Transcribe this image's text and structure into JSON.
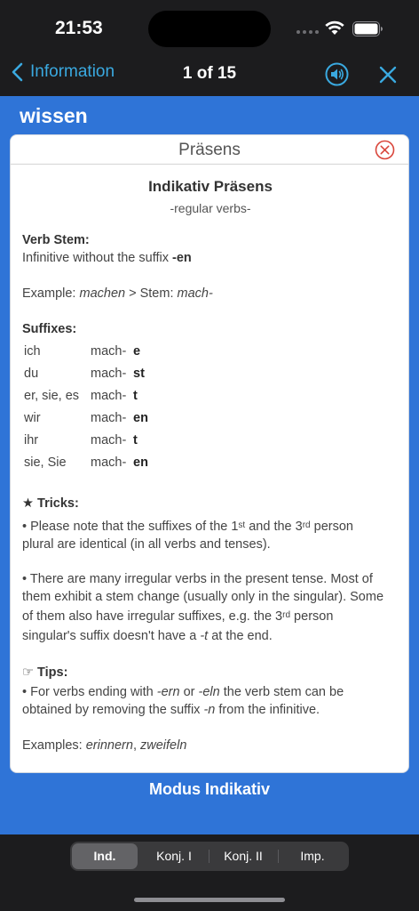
{
  "status_bar": {
    "time": "21:53"
  },
  "nav": {
    "back_label": "Information",
    "counter": "1 of 15",
    "accent_color": "#3aa9e0"
  },
  "verb": "wissen",
  "card": {
    "title": "Präsens",
    "heading": "Indikativ Präsens",
    "subheading": "-regular verbs-",
    "verb_stem": {
      "label": "Verb Stem:",
      "text": "Infinitive without the suffix ",
      "suffix": "-en"
    },
    "example": {
      "prefix": "Example: ",
      "word": "machen",
      "mid": " > Stem: ",
      "stem": "mach-"
    },
    "suffixes_label": "Suffixes:",
    "suffixes": [
      {
        "pronoun": "ich",
        "stem": "mach-",
        "ending": "e"
      },
      {
        "pronoun": "du",
        "stem": "mach-",
        "ending": "st"
      },
      {
        "pronoun": "er, sie, es",
        "stem": "mach-",
        "ending": "t"
      },
      {
        "pronoun": "wir",
        "stem": "mach-",
        "ending": "en"
      },
      {
        "pronoun": "ihr",
        "stem": "mach-",
        "ending": "t"
      },
      {
        "pronoun": "sie, Sie",
        "stem": "mach-",
        "ending": "en"
      }
    ],
    "tricks": {
      "label": "★ Tricks:",
      "t1_a": "• Please note that the suffixes of the 1",
      "t1_sup1": "st",
      "t1_b": " and the 3",
      "t1_sup2": "rd",
      "t1_c": " person",
      "t1_line2": "plural are identical (in all verbs and tenses).",
      "t2_line1": "• There are many irregular verbs in the present tense. Most of",
      "t2_line2": "them exhibit a stem change (usually only in the singular). Some",
      "t2_line3_a": "of them also have irregular suffixes, e.g. the 3",
      "t2_line3_sup": "rd",
      "t2_line3_b": " person",
      "t2_line4_a": "singular's suffix doesn't have a ",
      "t2_line4_i": "-t",
      "t2_line4_b": " at the end."
    },
    "tips": {
      "label": "☞ Tips:",
      "l1_a": "• For verbs ending with ",
      "l1_i1": "-ern",
      "l1_b": " or ",
      "l1_i2": "-eln",
      "l1_c": " the verb stem can be",
      "l2_a": "obtained by removing the suffix ",
      "l2_i": "-n",
      "l2_b": " from the infinitive.",
      "examples_prefix": "Examples: ",
      "examples_1": "erinnern",
      "examples_sep": ", ",
      "examples_2": "zweifeln"
    }
  },
  "modus_label": "Modus Indikativ",
  "tabs": [
    {
      "label": "Ind.",
      "active": true
    },
    {
      "label": "Konj. I",
      "active": false
    },
    {
      "label": "Konj. II",
      "active": false
    },
    {
      "label": "Imp.",
      "active": false
    }
  ],
  "colors": {
    "main_background": "#2f74d7",
    "bar_background": "#1c1c1e",
    "close_circle": "#d9453a"
  }
}
